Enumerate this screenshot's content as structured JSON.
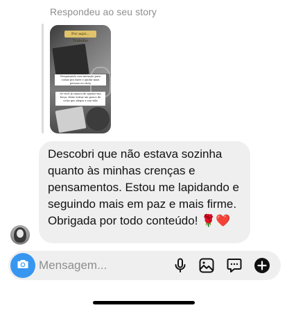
{
  "story_reply": {
    "label": "Respondeu ao seu story",
    "thumbnail": {
      "tag": "Por aqui... Trabalho",
      "card1": "Pesquisando com intenção para coisas pra fazer e ajudar mais pessoas no story",
      "card2": "Se você já cansou de ajustar sua força, deixe entrar um pouco de coisa que alegra a sua vida"
    }
  },
  "message": {
    "text": "Descobri que não estava sozinha quanto às minhas crenças e pensamentos. Estou me lapidando e seguindo mais em paz e mais firme. Obrigada por todo conteúdo! 🌹❤️"
  },
  "composer": {
    "placeholder": "Mensagem...",
    "icons": [
      "camera-icon",
      "microphone-icon",
      "gallery-icon",
      "sticker-icon",
      "plus-icon"
    ]
  },
  "colors": {
    "accent": "#3797f0",
    "bubble": "#efefef",
    "muted_text": "#8e8e8e"
  }
}
